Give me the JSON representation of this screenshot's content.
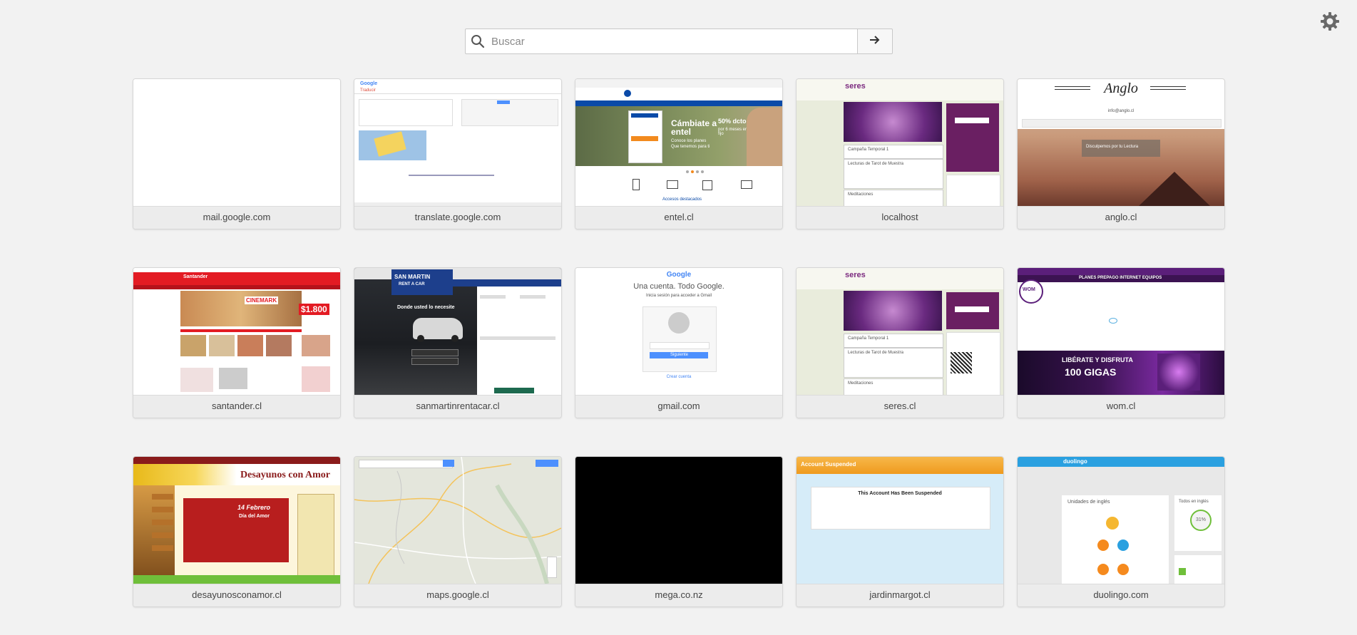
{
  "search": {
    "placeholder": "Buscar"
  },
  "icons": {
    "search": "search-icon",
    "go": "arrow-right-icon",
    "settings": "gear-icon"
  },
  "tiles": [
    {
      "label": "mail.google.com"
    },
    {
      "label": "translate.google.com",
      "thumb": {
        "brand": "Google",
        "sub": "Traducir"
      }
    },
    {
      "label": "entel.cl",
      "thumb": {
        "headline": "Cámbiate a entel",
        "line1": "Conoce los planes",
        "line2": "Que tenemos para ti",
        "accent": "50% dcto",
        "line3": "por 6 meses en cargo fijo",
        "footer": "Accesos destacados"
      }
    },
    {
      "label": "localhost",
      "thumb": {
        "brand": "seres",
        "card1": "Campaña Temporal 1",
        "card2": "Lecturas de Tarot de Muestra",
        "card3": "Meditaciones"
      }
    },
    {
      "label": "anglo.cl",
      "thumb": {
        "brand": "Anglo",
        "email": "info@anglo.cl",
        "note": "Disculpemos por tu Lectura"
      }
    },
    {
      "label": "santander.cl",
      "thumb": {
        "brand": "Santander",
        "promo": "CINEMARK",
        "price": "$1.800"
      }
    },
    {
      "label": "sanmartinrentacar.cl",
      "thumb": {
        "brand": "SAN MARTIN",
        "sub": "RENT A CAR",
        "headline": "Donde usted lo necesite"
      }
    },
    {
      "label": "gmail.com",
      "thumb": {
        "brand": "Google",
        "headline": "Una cuenta. Todo Google.",
        "sub": "Inicia sesión para acceder a Gmail",
        "button": "Siguiente",
        "link": "Crear cuenta"
      }
    },
    {
      "label": "seres.cl",
      "thumb": {
        "brand": "seres",
        "card1": "Campaña Temporal 1",
        "card2": "Lecturas de Tarot de Muestra",
        "card3": "Meditaciones"
      }
    },
    {
      "label": "wom.cl",
      "thumb": {
        "brand": "WOM",
        "nav": "PLANES  PREPAGO  INTERNET  EQUIPOS",
        "promo1": "LIBÉRATE Y DISFRUTA",
        "promo2": "100 GIGAS"
      }
    },
    {
      "label": "desayunosconamor.cl",
      "thumb": {
        "brand": "Desayunos con Amor",
        "date": "14 Febrero",
        "sub": "Día del Amor"
      }
    },
    {
      "label": "maps.google.cl"
    },
    {
      "label": "mega.co.nz"
    },
    {
      "label": "jardinmargot.cl",
      "thumb": {
        "header": "Account Suspended",
        "message": "This Account Has Been Suspended"
      }
    },
    {
      "label": "duolingo.com",
      "thumb": {
        "brand": "duolingo",
        "section": "Unidades de inglés",
        "side": "Todos en inglés",
        "percent": "31%"
      }
    }
  ],
  "colors": {
    "background": "#f2f2f2",
    "tile_label_bg": "#ececec",
    "entel_blue": "#0a4aa8",
    "santander_red": "#e31b23",
    "wom_purple": "#5b1f7a",
    "duolingo_blue": "#2aa0e0",
    "suspended_orange": "#f4a030"
  }
}
